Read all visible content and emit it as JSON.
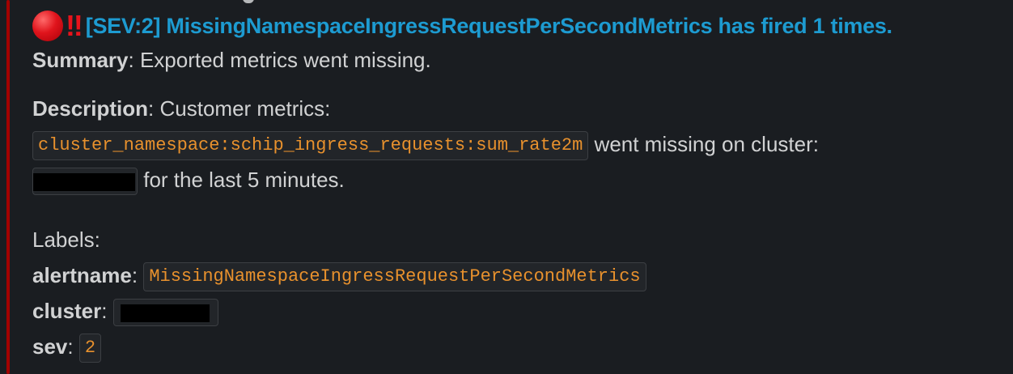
{
  "alert": {
    "emoji_circle": "red-circle-icon",
    "emoji_bang": "‼",
    "title": "[SEV:2] MissingNamespaceIngressRequestPerSecondMetrics has fired 1 times.",
    "accent_color": "#a30200",
    "link_color": "#1d9bd1"
  },
  "summary": {
    "label": "Summary",
    "sep": ":",
    "text": " Exported metrics went missing."
  },
  "description": {
    "label": "Description",
    "sep": ":",
    "text": " Customer metrics:",
    "metric_code": "cluster_namespace:schip_ingress_requests:sum_rate2m",
    "after_metric": " went missing on cluster:",
    "after_cluster": " for the last 5 minutes."
  },
  "labels": {
    "heading": "Labels:",
    "alertname_key": "alertname",
    "alertname_value": "MissingNamespaceIngressRequestPerSecondMetrics",
    "cluster_key": "cluster",
    "sev_key": "sev",
    "sev_value": "2",
    "sep": ":"
  }
}
